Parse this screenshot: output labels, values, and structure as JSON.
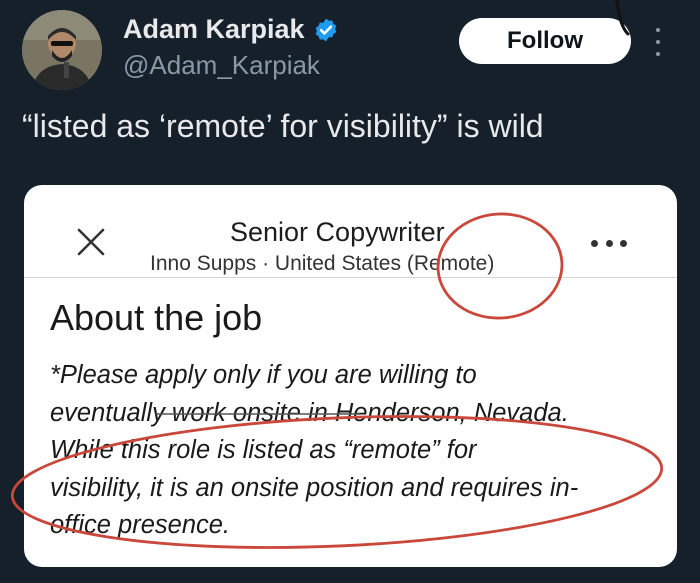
{
  "tweet": {
    "author_name": "Adam Karpiak",
    "handle": "@Adam_Karpiak",
    "follow_label": "Follow",
    "text": "“listed as ‘remote’ for visibility” is wild"
  },
  "job_card": {
    "title": "Senior Copywriter",
    "subtitle": "Inno Supps · United States (Remote)",
    "section_heading": "About the job",
    "description_lines": [
      "*Please apply only if you are willing to",
      "eventually work onsite in Henderson, Nevada.",
      "While this role is listed as “remote” for",
      "visibility, it is an onsite position and requires in-",
      "office presence."
    ]
  },
  "colors": {
    "background": "#15202b",
    "verified_badge": "#1d9bf0",
    "annotation_red": "#c9473b"
  },
  "icons": [
    "verified-badge-icon",
    "more-options-icon",
    "close-icon",
    "card-more-icon"
  ]
}
